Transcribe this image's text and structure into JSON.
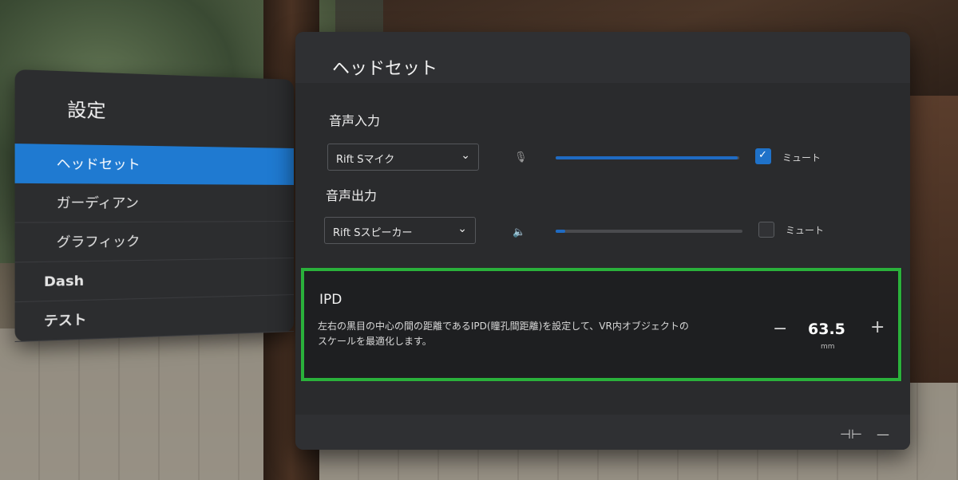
{
  "left_panel": {
    "title": "設定",
    "items": [
      {
        "label": "ヘッドセット"
      },
      {
        "label": "ガーディアン"
      },
      {
        "label": "グラフィック"
      },
      {
        "label": "Dash"
      },
      {
        "label": "テスト"
      }
    ]
  },
  "main_panel": {
    "title": "ヘッドセット",
    "audio_input": {
      "label": "音声入力",
      "device": "Rift Sマイク",
      "level": 0.99,
      "mute_label": "ミュート",
      "muted": true
    },
    "audio_output": {
      "label": "音声出力",
      "device": "Rift Sスピーカー",
      "level": 0.05,
      "mute_label": "ミュート",
      "muted": false
    },
    "ipd": {
      "title": "IPD",
      "description": "左右の黒目の中心の間の距離であるIPD(瞳孔間距離)を設定して、VR内オブジェクトのスケールを最適化します。",
      "value": "63.5",
      "unit": "mm",
      "minus": "−",
      "plus": "+"
    },
    "footer": {
      "pin_icon": "pin-icon",
      "minimize_icon": "minimize-icon"
    }
  },
  "colors": {
    "accent": "#1f7ad1",
    "highlight": "#2ab13b"
  }
}
